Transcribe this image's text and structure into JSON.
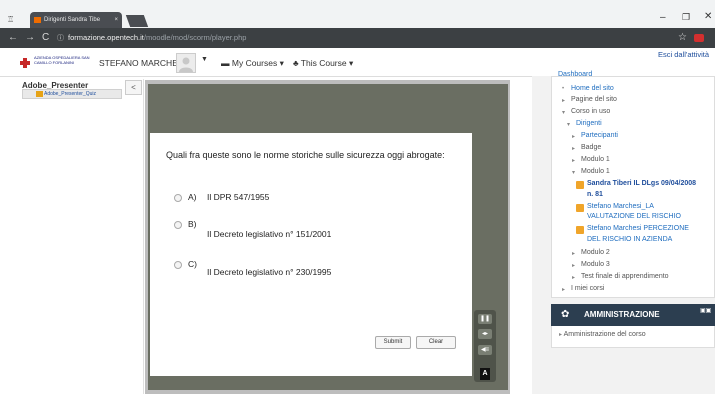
{
  "browser": {
    "tab_title": "Dirigenti Sandra Tibe",
    "tab_close": "×",
    "url_host": "formazione.opentech.it",
    "url_path": "/moodle/mod/scorm/player.php",
    "window_controls": {
      "minimize": "–",
      "maximize": "❐",
      "close": "✕"
    }
  },
  "header": {
    "logo_text": "AZIENDA OSPEDALIERA SAN CAMILLO FORLANINI",
    "user_name": "STEFANO MARCHESI",
    "my_courses": "My Courses",
    "this_course": "This Course",
    "exit_link": "Esci dall'attività"
  },
  "toc": {
    "title": "Adobe_Presenter",
    "item": "Adobe_Presenter_Quiz",
    "toggle": "<"
  },
  "quiz": {
    "question": "Quali fra queste sono le norme storiche sulle sicurezza oggi abrogate:",
    "options": [
      {
        "letter": "A)",
        "text": "Il DPR 547/1955"
      },
      {
        "letter": "B)",
        "text": "Il Decreto legislativo n° 151/2001"
      },
      {
        "letter": "C)",
        "text": "Il Decreto legislativo n° 230/1995"
      }
    ],
    "submit": "Submit",
    "clear": "Clear"
  },
  "navigation": {
    "header": "Dashboard",
    "items": [
      {
        "text": "Home del sito"
      },
      {
        "text": "Pagine del sito"
      },
      {
        "text": "Corso in uso"
      },
      {
        "text": "Dirigenti"
      },
      {
        "text": "Partecipanti"
      },
      {
        "text": "Badge"
      },
      {
        "text": "Modulo 1"
      },
      {
        "text": "Modulo 1"
      },
      {
        "text": "Sandra Tiberi IL DLgs 09/04/2008",
        "text2": "n. 81"
      },
      {
        "text": "Stefano Marchesi_LA",
        "text2": "VALUTAZIONE DEL RISCHIO"
      },
      {
        "text": "Stefano Marchesi PERCEZIONE",
        "text2": "DEL RISCHIO IN AZIENDA"
      },
      {
        "text": "Modulo 2"
      },
      {
        "text": "Modulo 3"
      },
      {
        "text": "Test finale di apprendimento"
      },
      {
        "text": "I miei corsi"
      }
    ]
  },
  "admin": {
    "title": "AMMINISTRAZIONE",
    "item": "Amministrazione del corso"
  }
}
